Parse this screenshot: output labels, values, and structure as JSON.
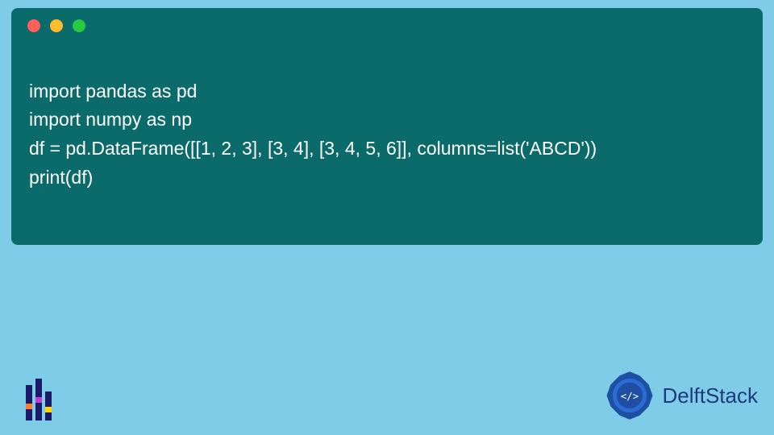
{
  "window": {
    "dots": [
      "red",
      "yellow",
      "green"
    ]
  },
  "code": {
    "lines": [
      "import pandas as pd",
      "import numpy as np",
      "df = pd.DataFrame([[1, 2, 3], [3, 4], [3, 4, 5, 6]], columns=list('ABCD'))",
      "print(df)"
    ]
  },
  "brand": {
    "name": "DelftStack"
  },
  "icons": {
    "left_logo": "pandas-bars-icon",
    "right_logo": "delftstack-gear-icon"
  }
}
